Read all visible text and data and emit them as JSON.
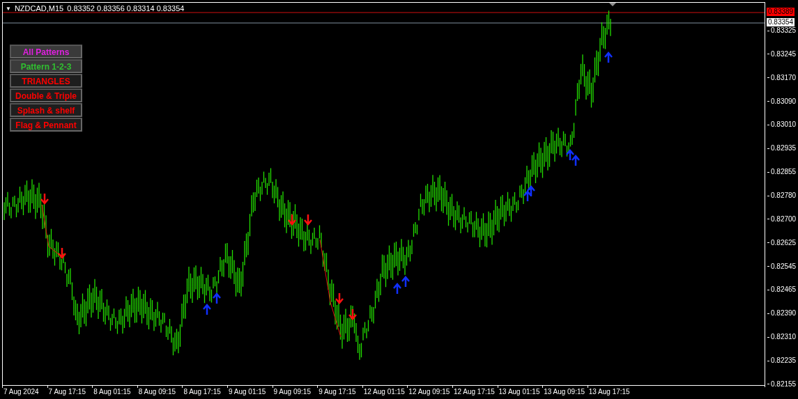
{
  "header": {
    "menu_glyph": "▼",
    "symbol": "NZDCAD,M15",
    "quote": "0.83352 0.83356 0.83314 0.83354"
  },
  "pattern_buttons": [
    {
      "label": "All Patterns",
      "color": "#e020e0",
      "selected": true
    },
    {
      "label": "Pattern 1-2-3",
      "color": "#30c030",
      "selected": true
    },
    {
      "label": "TRIANGLES",
      "color": "#ff0000",
      "selected": false
    },
    {
      "label": "Double & Triple",
      "color": "#ff0000",
      "selected": false
    },
    {
      "label": "Splash & shelf",
      "color": "#ff0000",
      "selected": false
    },
    {
      "label": "Flag & Pennant",
      "color": "#ff0000",
      "selected": false
    }
  ],
  "price_axis": {
    "bid_label": "0.83389",
    "last_label": "0.83354",
    "labels": [
      "0.83325",
      "0.83245",
      "0.83170",
      "0.83090",
      "0.83010",
      "0.82935",
      "0.82855",
      "0.82780",
      "0.82700",
      "0.82625",
      "0.82545",
      "0.82465",
      "0.82390",
      "0.82310",
      "0.82235",
      "0.82155"
    ]
  },
  "time_axis": [
    "7 Aug 2024",
    "7 Aug 17:15",
    "8 Aug 01:15",
    "8 Aug 09:15",
    "8 Aug 17:15",
    "9 Aug 01:15",
    "9 Aug 09:15",
    "9 Aug 17:15",
    "12 Aug 01:15",
    "12 Aug 09:15",
    "12 Aug 17:15",
    "13 Aug 01:15",
    "13 Aug 09:15",
    "13 Aug 17:15"
  ]
}
